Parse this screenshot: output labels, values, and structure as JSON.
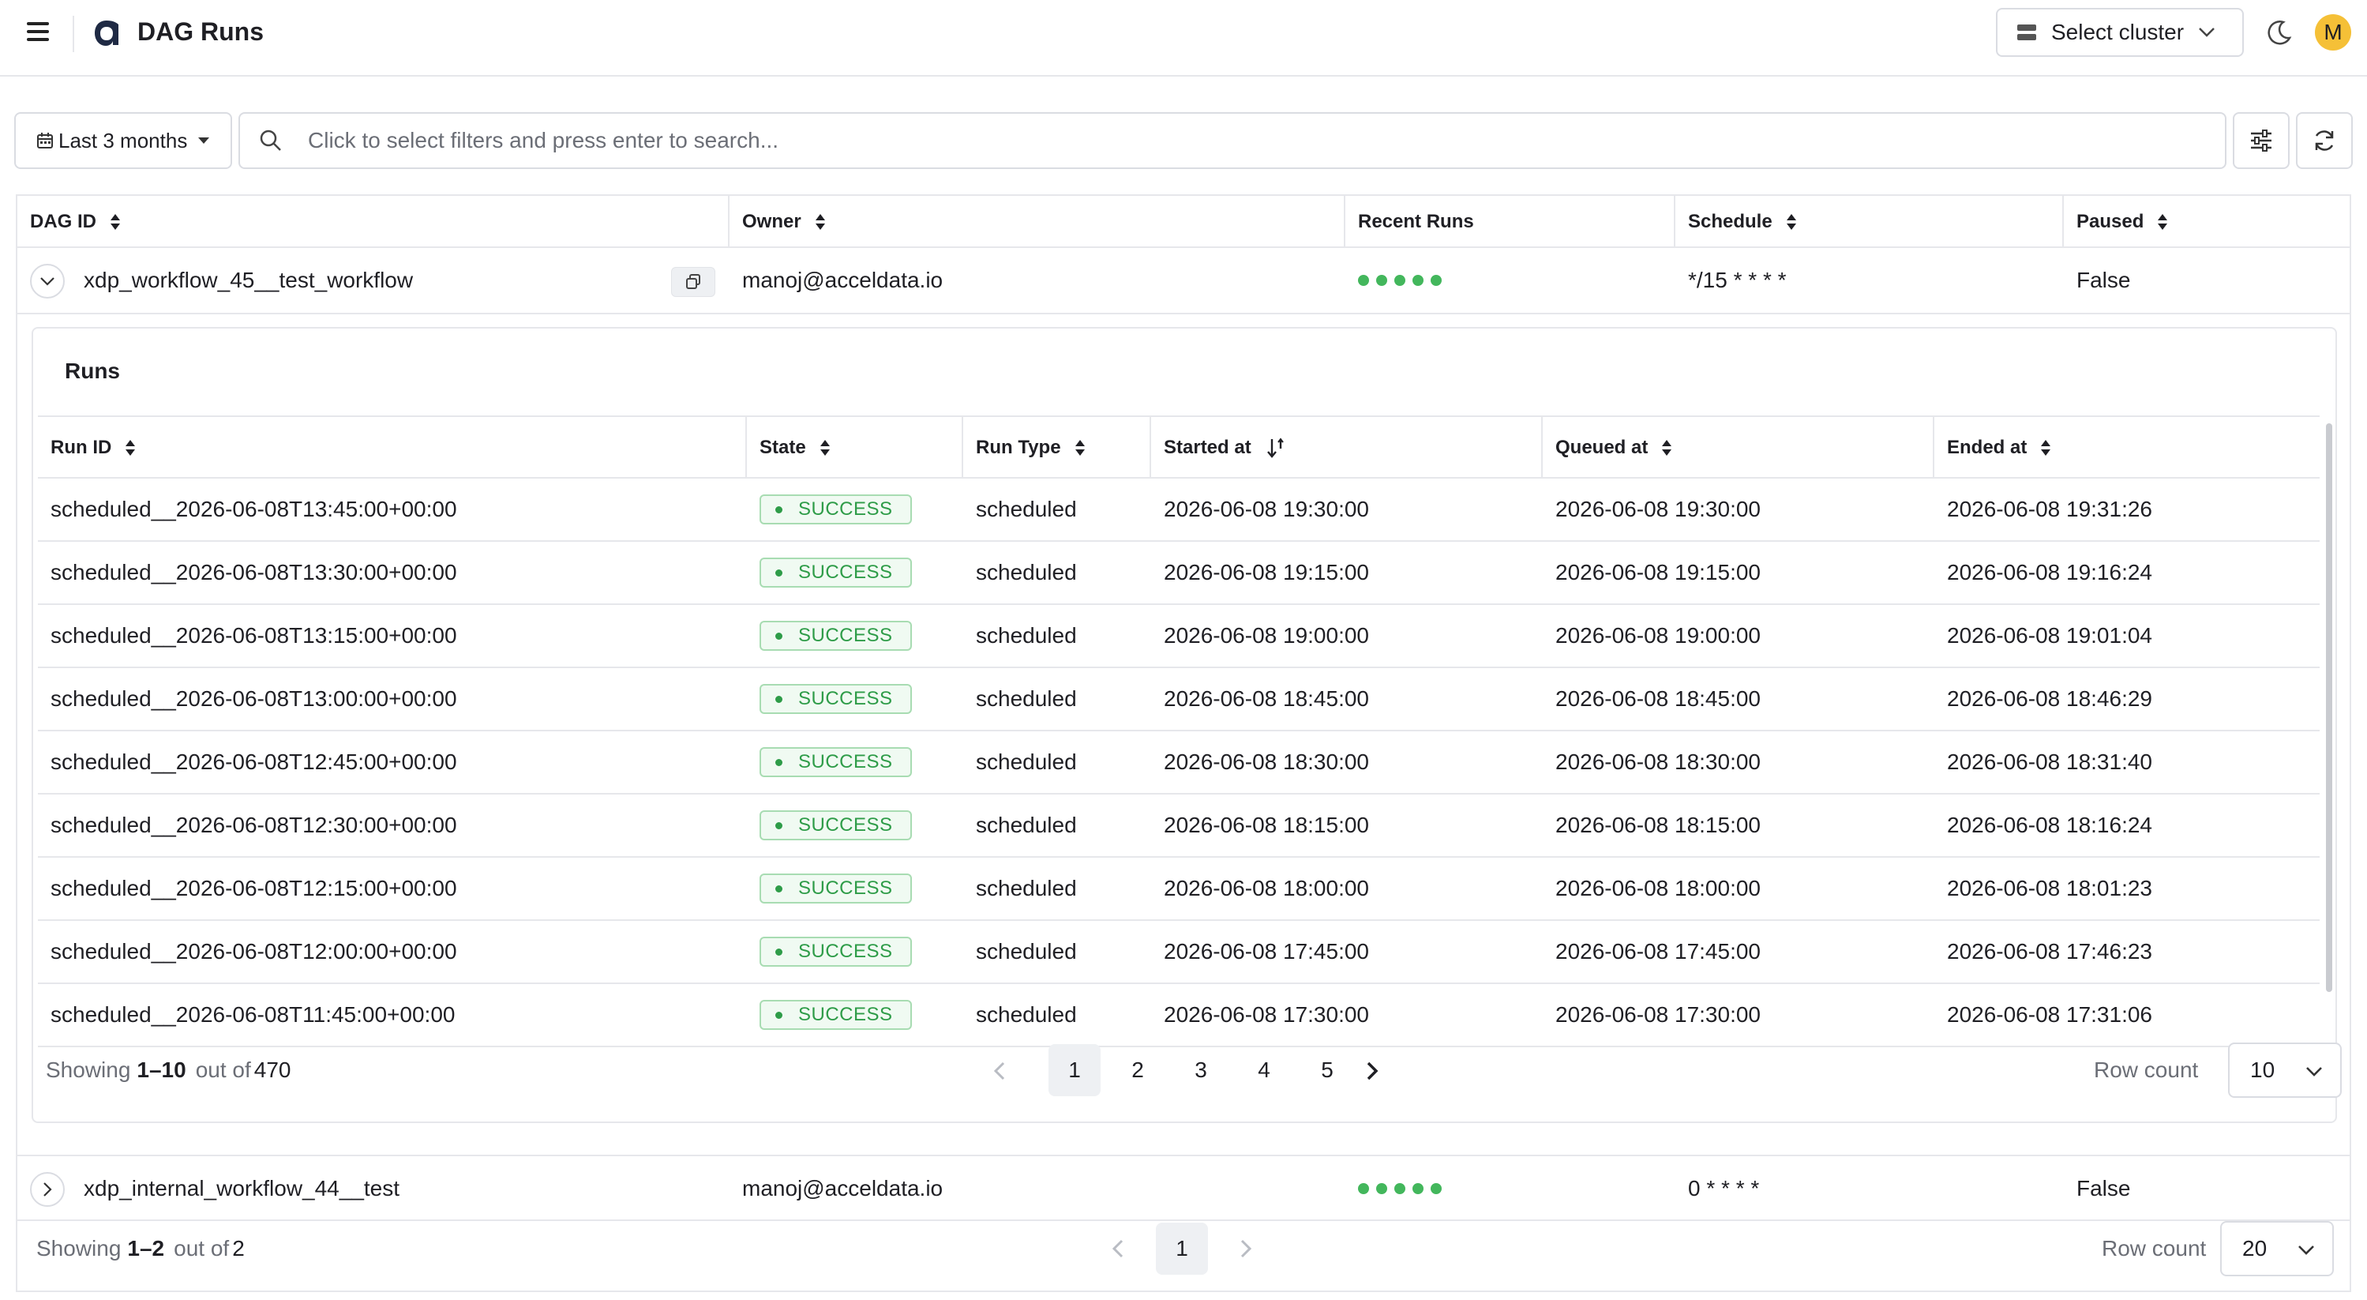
{
  "header": {
    "title": "DAG Runs",
    "cluster_label": "Select cluster",
    "avatar_initial": "M"
  },
  "filters": {
    "date_range": "Last 3 months",
    "search_placeholder": "Click to select filters and press enter to search..."
  },
  "colors": {
    "accent": "#1f2a44",
    "success": "#2e9c48",
    "recent_run_dot": "#43b75c",
    "avatar": "#f5c037"
  },
  "dag_table": {
    "columns": [
      "DAG ID",
      "Owner",
      "Recent Runs",
      "Schedule",
      "Paused"
    ],
    "rows": [
      {
        "dag_id": "xdp_workflow_45__test_workflow",
        "owner": "manoj@acceldata.io",
        "recent_runs": [
          "success",
          "success",
          "success",
          "success",
          "success"
        ],
        "schedule": "*/15 * * * *",
        "paused": "False",
        "expanded": true
      },
      {
        "dag_id": "xdp_internal_workflow_44__test",
        "owner": "manoj@acceldata.io",
        "recent_runs": [
          "success",
          "success",
          "success",
          "success",
          "success"
        ],
        "schedule": "0 * * * *",
        "paused": "False",
        "expanded": false
      }
    ],
    "pagination": {
      "showing_label": "Showing",
      "range": "1–2",
      "out_of_label": "out of",
      "total": "2",
      "pages": [
        "1"
      ],
      "active_page": "1",
      "row_count_label": "Row count",
      "row_count": "20"
    }
  },
  "runs_panel": {
    "title": "Runs",
    "columns": [
      "Run ID",
      "State",
      "Run Type",
      "Started at",
      "Queued at",
      "Ended at"
    ],
    "rows": [
      {
        "run_id": "scheduled__2026-06-08T13:45:00+00:00",
        "state": "SUCCESS",
        "run_type": "scheduled",
        "started": "2026-06-08 19:30:00",
        "queued": "2026-06-08 19:30:00",
        "ended": "2026-06-08 19:31:26"
      },
      {
        "run_id": "scheduled__2026-06-08T13:30:00+00:00",
        "state": "SUCCESS",
        "run_type": "scheduled",
        "started": "2026-06-08 19:15:00",
        "queued": "2026-06-08 19:15:00",
        "ended": "2026-06-08 19:16:24"
      },
      {
        "run_id": "scheduled__2026-06-08T13:15:00+00:00",
        "state": "SUCCESS",
        "run_type": "scheduled",
        "started": "2026-06-08 19:00:00",
        "queued": "2026-06-08 19:00:00",
        "ended": "2026-06-08 19:01:04"
      },
      {
        "run_id": "scheduled__2026-06-08T13:00:00+00:00",
        "state": "SUCCESS",
        "run_type": "scheduled",
        "started": "2026-06-08 18:45:00",
        "queued": "2026-06-08 18:45:00",
        "ended": "2026-06-08 18:46:29"
      },
      {
        "run_id": "scheduled__2026-06-08T12:45:00+00:00",
        "state": "SUCCESS",
        "run_type": "scheduled",
        "started": "2026-06-08 18:30:00",
        "queued": "2026-06-08 18:30:00",
        "ended": "2026-06-08 18:31:40"
      },
      {
        "run_id": "scheduled__2026-06-08T12:30:00+00:00",
        "state": "SUCCESS",
        "run_type": "scheduled",
        "started": "2026-06-08 18:15:00",
        "queued": "2026-06-08 18:15:00",
        "ended": "2026-06-08 18:16:24"
      },
      {
        "run_id": "scheduled__2026-06-08T12:15:00+00:00",
        "state": "SUCCESS",
        "run_type": "scheduled",
        "started": "2026-06-08 18:00:00",
        "queued": "2026-06-08 18:00:00",
        "ended": "2026-06-08 18:01:23"
      },
      {
        "run_id": "scheduled__2026-06-08T12:00:00+00:00",
        "state": "SUCCESS",
        "run_type": "scheduled",
        "started": "2026-06-08 17:45:00",
        "queued": "2026-06-08 17:45:00",
        "ended": "2026-06-08 17:46:23"
      },
      {
        "run_id": "scheduled__2026-06-08T11:45:00+00:00",
        "state": "SUCCESS",
        "run_type": "scheduled",
        "started": "2026-06-08 17:30:00",
        "queued": "2026-06-08 17:30:00",
        "ended": "2026-06-08 17:31:06"
      }
    ],
    "pagination": {
      "showing_label": "Showing",
      "range": "1–10",
      "out_of_label": "out of",
      "total": "470",
      "pages": [
        "1",
        "2",
        "3",
        "4",
        "5"
      ],
      "active_page": "1",
      "row_count_label": "Row count",
      "row_count": "10"
    }
  },
  "icons": {
    "menu": "hamburger-icon",
    "logo": "app-logo-icon",
    "cluster": "server-icon",
    "theme": "moon-icon",
    "calendar": "calendar-icon",
    "search": "search-icon",
    "filter": "sliders-icon",
    "refresh": "refresh-icon",
    "copy": "copy-icon",
    "expand": "chevron-down-icon",
    "collapse": "chevron-right-icon"
  }
}
